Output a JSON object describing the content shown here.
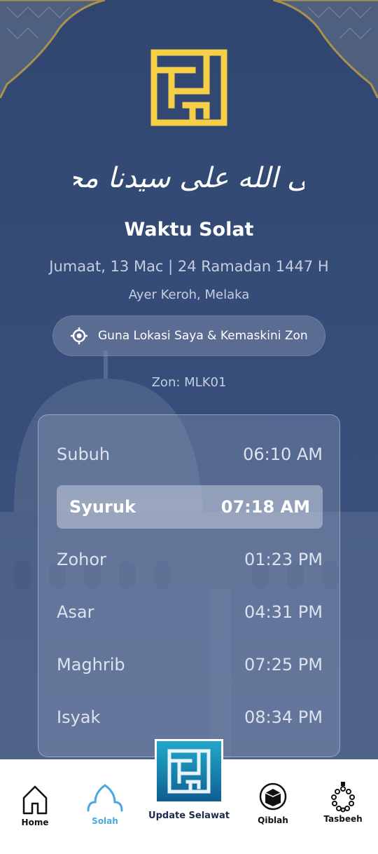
{
  "header": {
    "title": "Waktu Solat",
    "date": "Jumaat, 13 Mac | 24 Ramadan 1447 H",
    "location": "Ayer Keroh, Melaka",
    "location_button": "Guna Lokasi Saya & Kemaskini Zon",
    "zone": "Zon: MLK01",
    "calligraphy": "صلى الله على سيدنا محمد"
  },
  "prayers": [
    {
      "name": "Subuh",
      "time": "06:10 AM"
    },
    {
      "name": "Syuruk",
      "time": "07:18 AM"
    },
    {
      "name": "Zohor",
      "time": "01:23 PM"
    },
    {
      "name": "Asar",
      "time": "04:31 PM"
    },
    {
      "name": "Maghrib",
      "time": "07:25 PM"
    },
    {
      "name": "Isyak",
      "time": "08:34 PM"
    }
  ],
  "nav": {
    "home": "Home",
    "solah": "Solah",
    "update": "Update Selawat",
    "qiblah": "Qiblah",
    "tasbeeh": "Tasbeeh"
  },
  "colors": {
    "background": "#344a75",
    "logo_gold": "#f5cf45",
    "nav_active": "#4aa8e0",
    "update_button": "#1b8fb8"
  },
  "icons": [
    "location-target-icon",
    "home-icon",
    "mosque-dome-icon",
    "kaaba-icon",
    "prayer-beads-icon"
  ]
}
